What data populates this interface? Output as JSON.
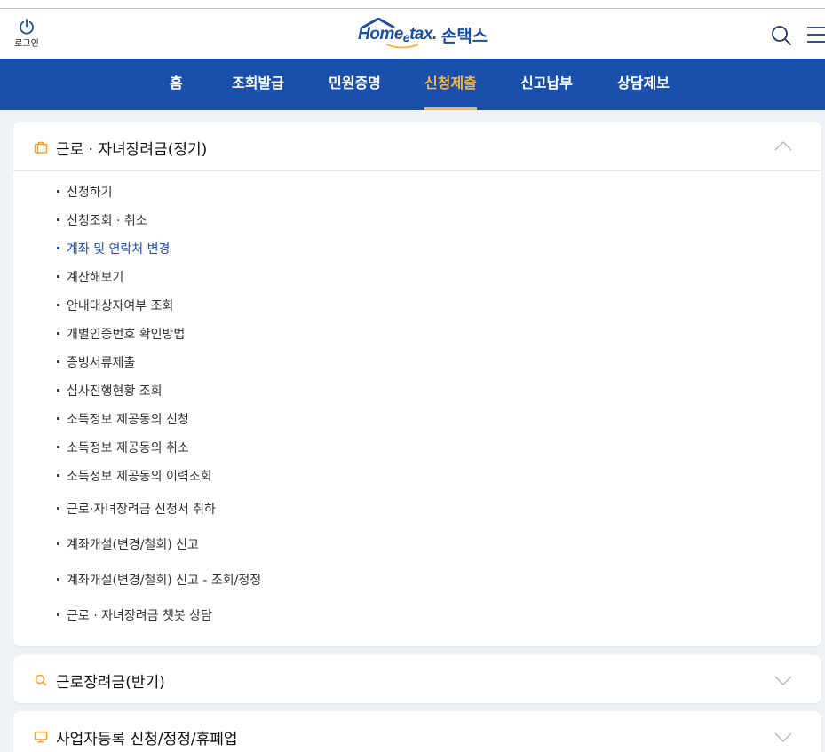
{
  "header": {
    "login_label": "로그인",
    "logo_text": "Home",
    "logo_e": "e",
    "logo_tax": "tax.",
    "logo_korean": "손택스",
    "icons": [
      "power-icon",
      "search-icon",
      "hamburger-menu-icon"
    ]
  },
  "nav": {
    "items": [
      {
        "label": "홈"
      },
      {
        "label": "조회발급"
      },
      {
        "label": "민원증명"
      },
      {
        "label": "신청제출",
        "active": true
      },
      {
        "label": "신고납부"
      },
      {
        "label": "상담제보"
      }
    ]
  },
  "sections": [
    {
      "title": "근로 · 자녀장려금(정기)",
      "icon": "briefcase-icon",
      "expanded": true,
      "items": [
        {
          "label": "신청하기"
        },
        {
          "label": "신청조회 · 취소"
        },
        {
          "label": "계좌 및 연락처 변경",
          "active": true
        },
        {
          "label": "계산해보기"
        },
        {
          "label": "안내대상자여부 조회"
        },
        {
          "label": "개별인증번호 확인방법"
        },
        {
          "label": "증빙서류제출"
        },
        {
          "label": "심사진행현황 조회"
        },
        {
          "label": "소득정보 제공동의 신청"
        },
        {
          "label": "소득정보 제공동의 취소"
        },
        {
          "label": "소득정보 제공동의 이력조회"
        },
        {
          "label": "근로·자녀장려금 신청서 취하"
        },
        {
          "label": "계좌개설(변경/철회) 신고"
        },
        {
          "label": "계좌개설(변경/철회) 신고 - 조회/정정"
        },
        {
          "label": "근로 · 자녀장려금 챗봇 상담"
        }
      ]
    },
    {
      "title": "근로장려금(반기)",
      "icon": "search-icon",
      "expanded": false
    },
    {
      "title": "사업자등록 신청/정정/휴폐업",
      "icon": "monitor-icon",
      "expanded": false
    }
  ],
  "colors": {
    "primary": "#1a4fac",
    "accent": "#f5b544",
    "background": "#eef1f5"
  }
}
